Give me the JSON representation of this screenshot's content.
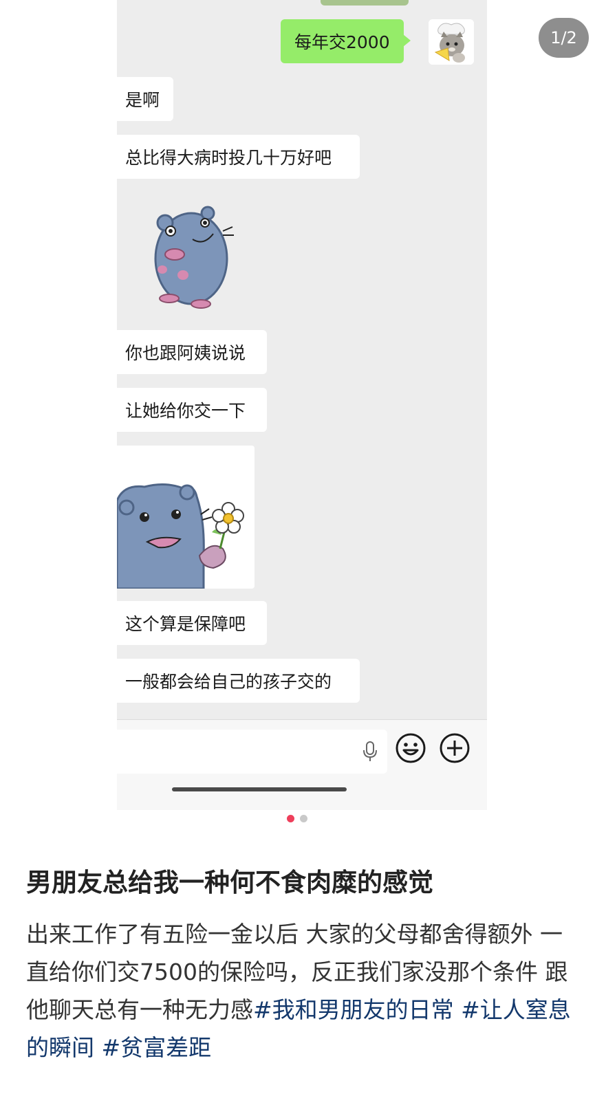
{
  "page_indicator": "1/2",
  "chat": {
    "my_message": "每年交2000",
    "messages": [
      "是啊",
      "总比得大病时投几十万好吧",
      "你也跟阿姨说说",
      "让她给你交一下",
      "这个算是保障吧",
      "一般都会给自己的孩子交的"
    ],
    "stickers": [
      "blue-hamster-sticker",
      "hamster-with-flower-sticker"
    ],
    "avatar": "cat-chef-avatar"
  },
  "input_bar": {
    "icons": [
      "microphone-icon",
      "emoji-icon",
      "plus-icon"
    ]
  },
  "carousel": {
    "total": 2,
    "active": 0,
    "active_color": "#ee3f5b"
  },
  "post": {
    "title": "男朋友总给我一种何不食肉糜的感觉",
    "body_text": "出来工作了有五险一金以后  大家的父母都舍得额外  一直给你们交7500的保险吗，反正我们家没那个条件   跟他聊天总有一种无力感",
    "hashtags": [
      "#我和男朋友的日常",
      "#让人窒息的瞬间",
      "#贫富差距"
    ],
    "hashtag_color": "#13386c"
  },
  "colors": {
    "chat_background": "#ededed",
    "my_bubble": "#95ec69",
    "their_bubble": "#ffffff"
  }
}
